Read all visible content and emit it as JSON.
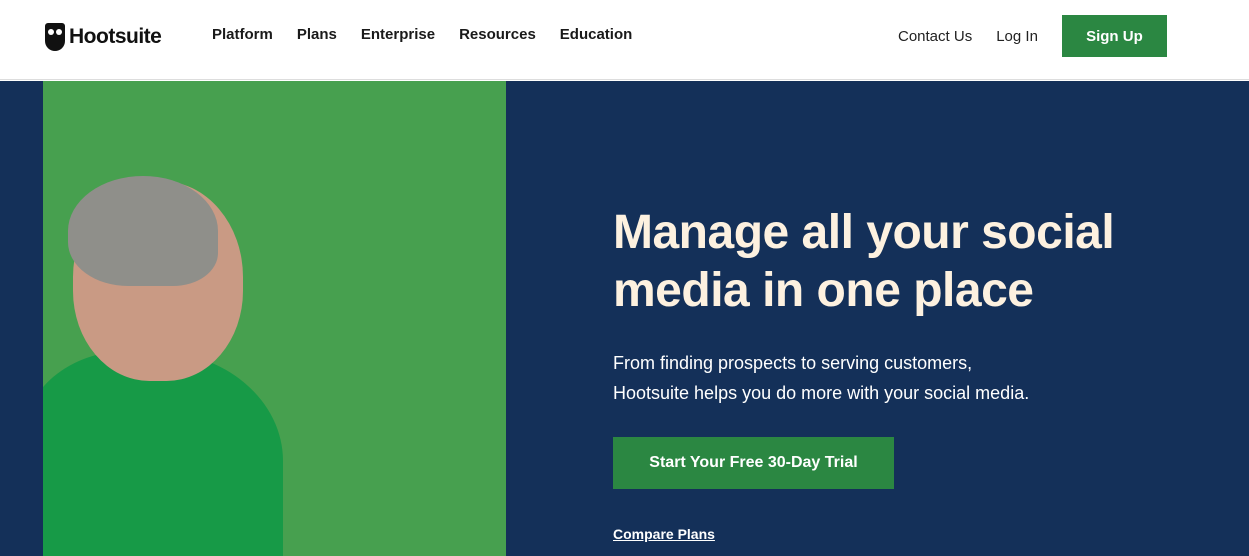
{
  "nav": {
    "logo": "Hootsuite",
    "menu": [
      "Platform",
      "Plans",
      "Enterprise",
      "Resources",
      "Education"
    ],
    "contact": "Contact Us",
    "login": "Log In",
    "signup": "Sign Up"
  },
  "hero": {
    "title": "Manage all your social media in one place",
    "subtitle_line1": "From finding prospects to serving customers,",
    "subtitle_line2": "Hootsuite helps you do more with your social media.",
    "cta": "Start Your Free 30-Day Trial",
    "compare": "Compare Plans"
  },
  "colors": {
    "navy": "#143059",
    "green": "#2b8742",
    "headline": "#fdf1e0"
  }
}
